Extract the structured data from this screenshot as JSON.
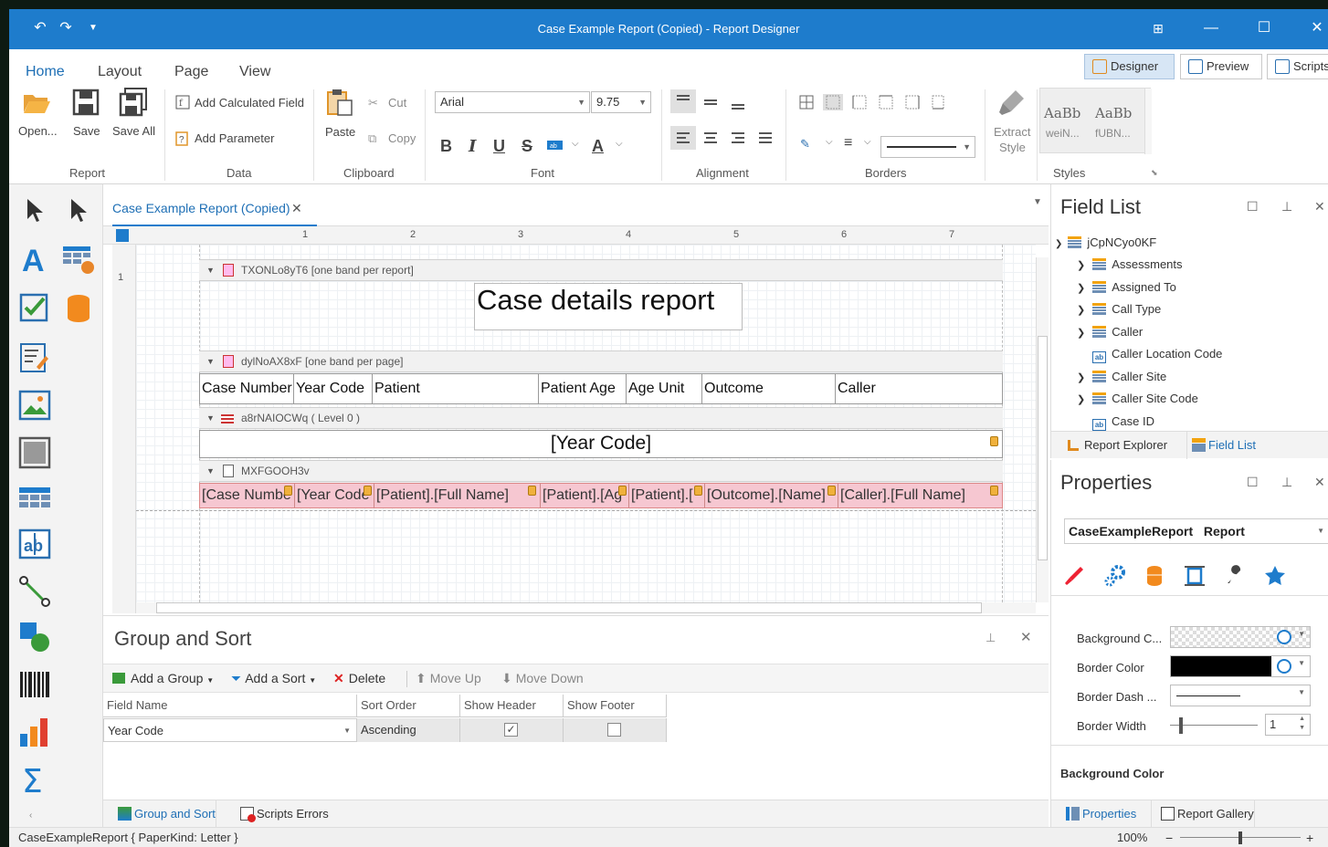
{
  "window": {
    "title": "Case Example Report (Copied) - Report Designer"
  },
  "ribbon_tabs": [
    "Home",
    "Layout",
    "Page",
    "View"
  ],
  "view_buttons": {
    "designer": "Designer",
    "preview": "Preview",
    "scripts": "Scripts"
  },
  "ribbon": {
    "report": {
      "label": "Report",
      "open": "Open...",
      "save": "Save",
      "save_all": "Save All"
    },
    "data": {
      "label": "Data",
      "add_calculated_field": "Add Calculated Field",
      "add_parameter": "Add Parameter"
    },
    "clipboard": {
      "label": "Clipboard",
      "paste": "Paste",
      "cut": "Cut",
      "copy": "Copy"
    },
    "font": {
      "label": "Font",
      "family": "Arial",
      "size": "9.75",
      "bold": "B",
      "italic": "I",
      "underline": "U",
      "strike": "S",
      "color": "A"
    },
    "alignment": {
      "label": "Alignment"
    },
    "borders": {
      "label": "Borders"
    },
    "extract_style": {
      "line1": "Extract",
      "line2": "Style"
    },
    "styles": {
      "label": "Styles",
      "sample1": "AaBb",
      "sample1_name": "weiN...",
      "sample2": "AaBb",
      "sample2_name": "fUBN..."
    }
  },
  "doc_tab": {
    "title": "Case Example Report (Copied)"
  },
  "ruler": {
    "marks": [
      "1",
      "2",
      "3",
      "4",
      "5",
      "6",
      "7"
    ],
    "vmark": "1"
  },
  "report": {
    "band1": {
      "name": "TXONLo8yT6 [one band per report]",
      "title_text": "Case details report"
    },
    "band2": {
      "name": "dylNoAX8xF [one band per page]",
      "headers": [
        "Case Number",
        "Year Code",
        "Patient",
        "Patient Age",
        "Age Unit",
        "Outcome",
        "Caller"
      ]
    },
    "band3": {
      "name": "a8rNAIOCWq ( Level 0 )",
      "group_field": "[Year Code]"
    },
    "band4": {
      "name": "MXFGOOH3v",
      "cells": [
        "[Case Numbe",
        "[Year Code",
        "[Patient].[Full Name]",
        "[Patient].[Ag",
        "[Patient].[",
        "[Outcome].[Name]",
        "[Caller].[Full Name]"
      ]
    }
  },
  "group_sort": {
    "title": "Group and Sort",
    "add_group": "Add a Group",
    "add_sort": "Add a Sort",
    "delete": "Delete",
    "move_up": "Move Up",
    "move_down": "Move Down",
    "columns": [
      "Field Name",
      "Sort Order",
      "Show Header",
      "Show Footer"
    ],
    "row": {
      "field_name": "Year Code",
      "sort_order": "Ascending",
      "show_header": true,
      "show_footer": false
    }
  },
  "bottom_tabs_left": {
    "group_sort": "Group and Sort",
    "scripts_errors": "Scripts Errors"
  },
  "field_list": {
    "title": "Field List",
    "root": "jCpNCyo0KF",
    "items": [
      {
        "label": "Assessments",
        "type": "table",
        "expandable": true
      },
      {
        "label": "Assigned To",
        "type": "table",
        "expandable": true
      },
      {
        "label": "Call Type",
        "type": "table",
        "expandable": true
      },
      {
        "label": "Caller",
        "type": "table",
        "expandable": true
      },
      {
        "label": "Caller Location Code",
        "type": "field",
        "expandable": false
      },
      {
        "label": "Caller Site",
        "type": "table",
        "expandable": true
      },
      {
        "label": "Caller Site Code",
        "type": "table",
        "expandable": true
      },
      {
        "label": "Case ID",
        "type": "field",
        "expandable": false
      }
    ],
    "tabs": {
      "report_explorer": "Report Explorer",
      "field_list": "Field List"
    }
  },
  "properties": {
    "title": "Properties",
    "object_name": "CaseExampleReport",
    "object_type": "Report",
    "rows": [
      {
        "label": "Background C..."
      },
      {
        "label": "Border Color"
      },
      {
        "label": "Border Dash ..."
      },
      {
        "label": "Border Width",
        "value": "1"
      }
    ],
    "section_title": "Background Color",
    "tabs": {
      "properties": "Properties",
      "report_gallery": "Report Gallery"
    },
    "accent": "#1e7ccc"
  },
  "status": {
    "left": "CaseExampleReport { PaperKind: Letter }",
    "zoom": "100%",
    "zoom_level": 0.5
  }
}
